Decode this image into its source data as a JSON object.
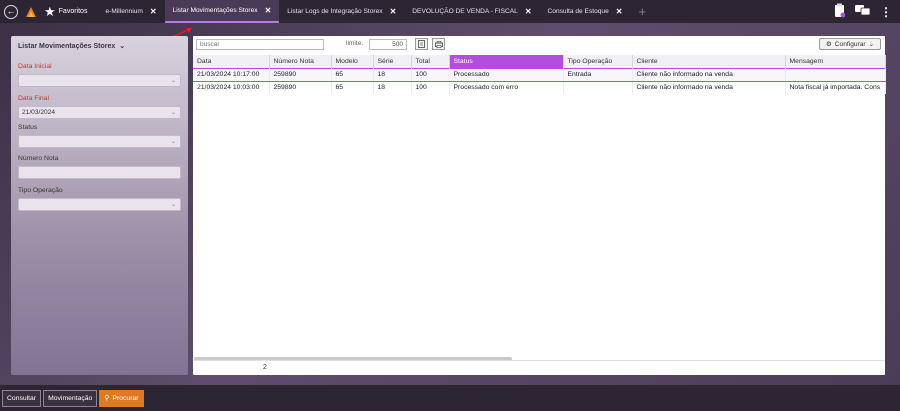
{
  "topbar": {
    "favorites_label": "Favoritos",
    "tabs": [
      {
        "label": "e-Millennium",
        "active": false
      },
      {
        "label": "Listar Movimentações Storex",
        "active": true
      },
      {
        "label": "Listar Logs de Integração Storex",
        "active": false
      },
      {
        "label": "DEVOLUÇÃO DE VENDA - FISCAL",
        "active": false
      },
      {
        "label": "Consulta de Estoque",
        "active": false
      }
    ],
    "close_glyph": "✕",
    "add_tab_glyph": "+"
  },
  "filters": {
    "title": "Listar Movimentações Storex",
    "data_inicial_label": "Data Inicial",
    "data_inicial_value": "",
    "data_final_label": "Data Final",
    "data_final_value": "21/03/2024",
    "status_label": "Status",
    "status_value": "",
    "numero_nota_label": "Número Nota",
    "numero_nota_value": "",
    "tipo_operacao_label": "Tipo Operação",
    "tipo_operacao_value": ""
  },
  "grid": {
    "search_placeholder": "buscar",
    "limit_label": "limite:",
    "limit_value": "500",
    "config_label": "Configurar",
    "columns": [
      "Data",
      "Número Nota",
      "Modelo",
      "Série",
      "Total",
      "Status",
      "Tipo Operação",
      "Cliente",
      "Mensagem"
    ],
    "rows": [
      [
        "21/03/2024 10:17:00",
        "259890",
        "65",
        "18",
        "100",
        "Processado",
        "Entrada",
        "Cliente não informado na venda",
        ""
      ],
      [
        "21/03/2024 10:03:00",
        "259890",
        "65",
        "18",
        "100",
        "Processado com erro",
        "",
        "Cliente não informado na venda",
        "Nota fiscal já importada. Cons"
      ]
    ],
    "record_count": "2"
  },
  "bottombar": {
    "consultar": "Consultar",
    "movimentacao": "Movimentação",
    "procurar": "Procurar"
  },
  "colors": {
    "accent": "#b24ddf",
    "primary_button": "#e07a20",
    "bar_bg": "#2c2533",
    "arrow": "#e0201b"
  }
}
